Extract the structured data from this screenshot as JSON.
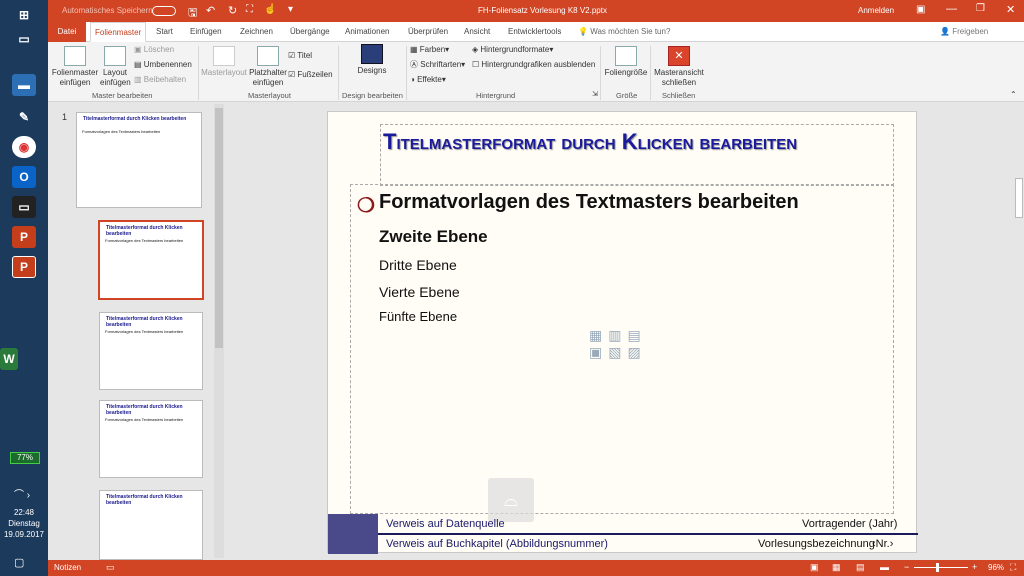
{
  "taskbar": {
    "battery": "77%",
    "time": "22:48",
    "day": "Dienstag",
    "date": "19.09.2017"
  },
  "titlebar": {
    "autosave": "Automatisches Speichern",
    "filename": "FH-Foliensatz Vorlesung K8 V2.pptx",
    "signin": "Anmelden"
  },
  "tabs": [
    "Datei",
    "Folienmaster",
    "Start",
    "Einfügen",
    "Zeichnen",
    "Übergänge",
    "Animationen",
    "Überprüfen",
    "Ansicht",
    "Entwicklertools"
  ],
  "tellme": "Was möchten Sie tun?",
  "share": "Freigeben",
  "ribbon": {
    "insert_master": "Folienmaster einfügen",
    "insert_layout": "Layout einfügen",
    "delete": "Löschen",
    "rename": "Umbenennen",
    "keep": "Beibehalten",
    "masterlayout": "Masterlayout",
    "placeholder": "Platzhalter einfügen",
    "title_chk": "Titel",
    "footer_chk": "Fußzeilen",
    "designs": "Designs",
    "colors": "Farben",
    "fonts": "Schriftarten",
    "effects": "Effekte",
    "bgformats": "Hintergrundformate",
    "hidebg": "Hintergrundgrafiken ausblenden",
    "slidesize": "Foliengröße",
    "closemaster": "Masteransicht schließen",
    "groups": [
      "Master bearbeiten",
      "Masterlayout",
      "Design bearbeiten",
      "Hintergrund",
      "Größe",
      "Schließen"
    ]
  },
  "panel": {
    "slide_number": "1"
  },
  "slide": {
    "title": "Titelmasterformat durch Klicken bearbeiten",
    "levels": [
      "Formatvorlagen des Textmasters bearbeiten",
      "Zweite Ebene",
      "Dritte Ebene",
      "Vierte Ebene",
      "Fünfte Ebene"
    ],
    "footer": {
      "ref_source": "Verweis auf Datenquelle",
      "presenter": "Vortragender (Jahr)",
      "ref_book": "Verweis auf Buchkapitel (Abbildungsnummer)",
      "lecture": "Vorlesungsbezeichnung",
      "num": "‹Nr.›"
    }
  },
  "thumb": {
    "title": "Titelmasterformat durch Klicken bearbeiten",
    "body": "Formatvorlagen des Textmasters bearbeiten"
  },
  "status": {
    "notes": "Notizen",
    "zoom": "96%"
  },
  "colors": {
    "accent": "#d14424",
    "title": "#1a1a9c"
  }
}
